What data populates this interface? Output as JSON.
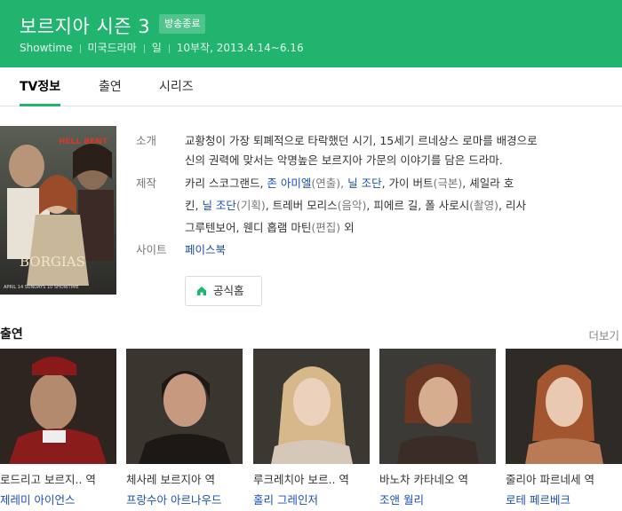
{
  "header": {
    "title": "보르지아 시즌 3",
    "status_badge": "방송종료",
    "meta": [
      "Showtime",
      "미국드라마",
      "일",
      "10부작, 2013.4.14~6.16"
    ]
  },
  "tabs": [
    "TV정보",
    "출연",
    "시리즈"
  ],
  "poster": {
    "caption_top": "HELL BENT",
    "caption_title": "BORGIAS",
    "caption_bottom": "APRIL 14 SUNDAYS 10 SHOWTIME"
  },
  "info": {
    "intro_label": "소개",
    "intro_line1": "교황청이 가장 퇴폐적으로 타락했던 시기, 15세기 르네상스 로마를 배경으로",
    "intro_line2": "신의 권력에 맞서는 악명높은 보르지아 가문의 이야기를 담은 드라마.",
    "production_label": "제작",
    "production": [
      {
        "text": "카리 스코그랜드, ",
        "link": false
      },
      {
        "text": "존 아미엘",
        "link": true
      },
      {
        "text": "(연출), ",
        "link": false,
        "muted": true
      },
      {
        "text": "닐 조단",
        "link": true
      },
      {
        "text": ", 가이 버트",
        "link": false
      },
      {
        "text": "(극본)",
        "link": false,
        "muted": true
      },
      {
        "text": ", 셰일라 호",
        "link": false
      }
    ],
    "production_line2": [
      {
        "text": "킨, ",
        "link": false
      },
      {
        "text": "닐 조단",
        "link": true
      },
      {
        "text": "(기획)",
        "link": false,
        "muted": true
      },
      {
        "text": ", 트레버 모리스",
        "link": false
      },
      {
        "text": "(음악)",
        "link": false,
        "muted": true
      },
      {
        "text": ", 피에르 길, 폴 사로시",
        "link": false
      },
      {
        "text": "(촬영)",
        "link": false,
        "muted": true
      },
      {
        "text": ", 리사",
        "link": false
      }
    ],
    "production_line3": [
      {
        "text": "그루텐보어, 웬디 홉램 마틴",
        "link": false
      },
      {
        "text": "(편집)",
        "link": false,
        "muted": true
      },
      {
        "text": " 외",
        "link": false
      }
    ],
    "site_label": "사이트",
    "site_link": "페이스북",
    "home_button": "공식홈"
  },
  "cast": {
    "heading": "출연",
    "more": "더보기",
    "members": [
      {
        "role": "로드리고 보르지.. 역",
        "actor": "제레미 아이언스"
      },
      {
        "role": "체사레 보르지아 역",
        "actor": "프랑수아 아르나우드"
      },
      {
        "role": "루크레치아 보르.. 역",
        "actor": "홀리 그레인저"
      },
      {
        "role": "바노차 카타네오 역",
        "actor": "조앤 월리"
      },
      {
        "role": "줄리아 파르네세 역",
        "actor": "로테 페르베크"
      }
    ]
  },
  "colors": {
    "brand": "#20b46f",
    "link": "#1a4fb5"
  }
}
